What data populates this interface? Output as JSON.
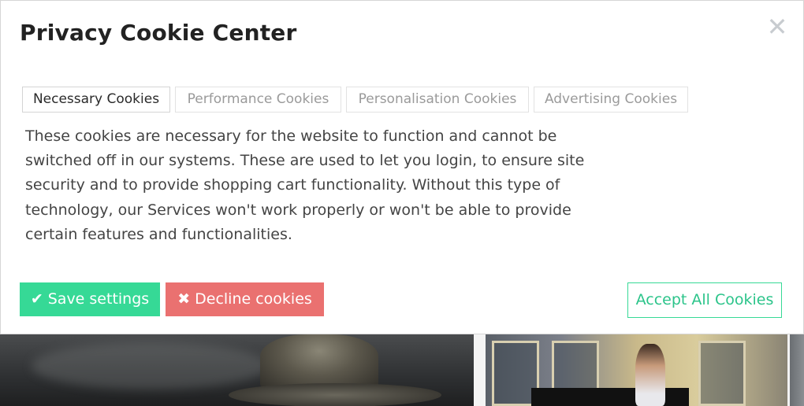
{
  "modal": {
    "title": "Privacy Cookie Center",
    "close_icon": "close-icon"
  },
  "tabs": [
    {
      "label": "Necessary Cookies",
      "active": true
    },
    {
      "label": "Performance Cookies",
      "active": false
    },
    {
      "label": "Personalisation Cookies",
      "active": false
    },
    {
      "label": "Advertising Cookies",
      "active": false
    }
  ],
  "description": "These cookies are necessary for the website to function and cannot be switched off in our systems. These are used to let you login, to ensure site security and to provide shopping cart functionality. Without this type of technology, our Services won't work properly or won't be able to provide certain features and functionalities.",
  "buttons": {
    "save": {
      "label": "Save settings",
      "icon": "check-icon"
    },
    "decline": {
      "label": "Decline cookies",
      "icon": "x-icon"
    },
    "accept": {
      "label": "Accept All Cookies"
    }
  },
  "colors": {
    "save": "#36d996",
    "decline": "#ea7170",
    "accept_text": "#2bc48a"
  }
}
